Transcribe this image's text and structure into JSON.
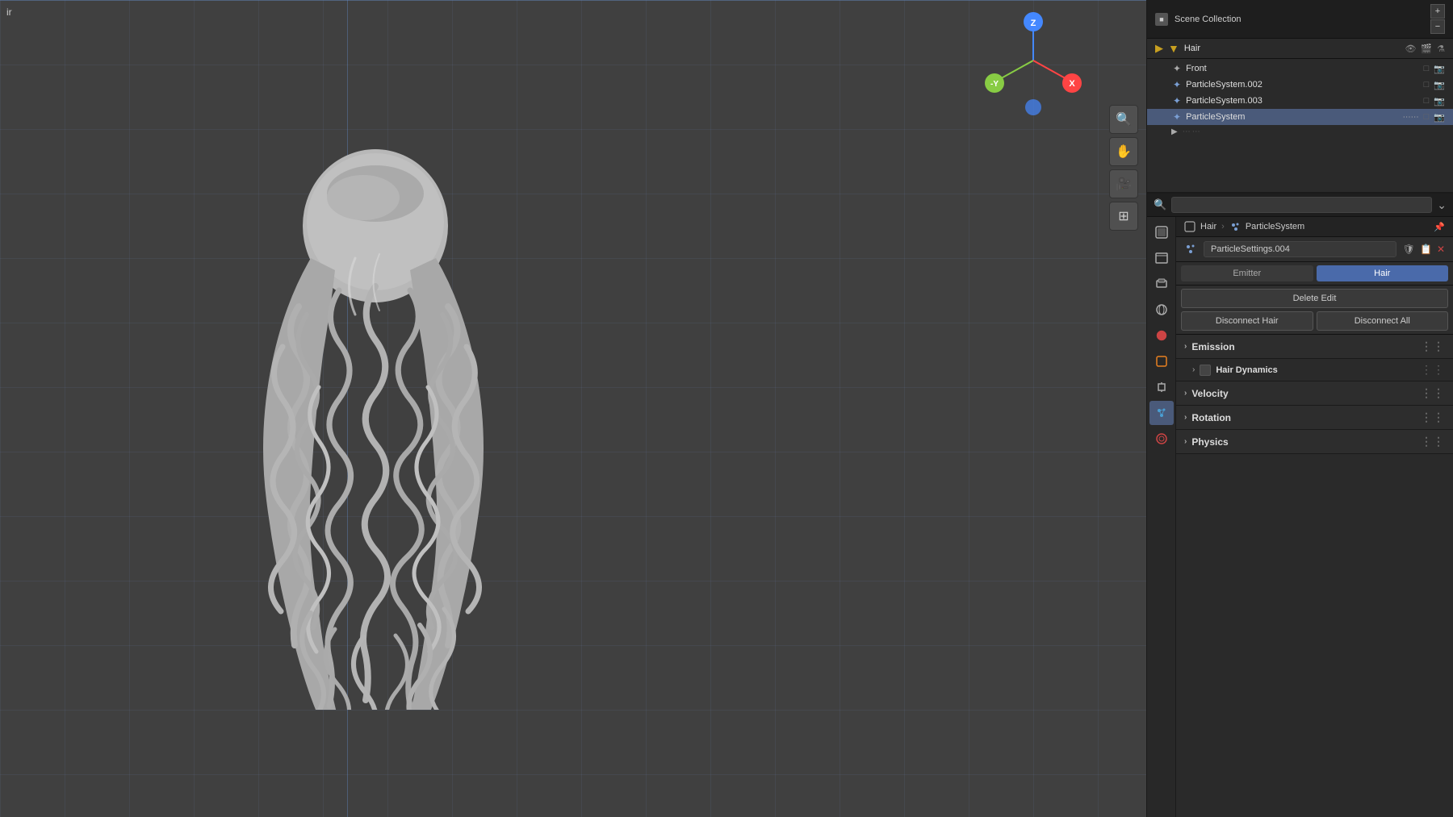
{
  "viewport": {
    "label": "ir",
    "background_color": "#3d3d3d"
  },
  "outliner": {
    "title": "Scene Collection",
    "search_placeholder": "🔍",
    "items": [
      {
        "id": "front",
        "label": "Front",
        "icon": "📷",
        "active": false
      },
      {
        "id": "ps002",
        "label": "ParticleSystem.002",
        "icon": "✦",
        "active": false
      },
      {
        "id": "ps003",
        "label": "ParticleSystem.003",
        "icon": "✦",
        "active": false
      },
      {
        "id": "ps",
        "label": "ParticleSystem",
        "icon": "✦",
        "active": true
      }
    ],
    "hair_label": "Hair",
    "expand_icon": "⌄"
  },
  "breadcrumb": {
    "items": [
      "Hair",
      "ParticleSystem"
    ],
    "icons": [
      "□",
      "✦"
    ]
  },
  "particle_settings": {
    "name": "ParticleSettings.004",
    "tabs": [
      {
        "id": "emitter",
        "label": "Emitter",
        "active": false
      },
      {
        "id": "hair",
        "label": "Hair",
        "active": true
      }
    ],
    "delete_edit_label": "Delete Edit",
    "disconnect_hair_label": "Disconnect Hair",
    "disconnect_all_label": "Disconnect All"
  },
  "sections": [
    {
      "id": "emission",
      "label": "Emission",
      "expanded": false
    },
    {
      "id": "hair_dynamics",
      "label": "Hair Dynamics",
      "expanded": false,
      "has_checkbox": true
    },
    {
      "id": "velocity",
      "label": "Velocity",
      "expanded": false
    },
    {
      "id": "rotation",
      "label": "Rotation",
      "expanded": false
    },
    {
      "id": "physics",
      "label": "Physics",
      "expanded": false
    }
  ],
  "props_sidebar": {
    "icons": [
      {
        "id": "render",
        "symbol": "🎬",
        "title": "Render Properties"
      },
      {
        "id": "output",
        "symbol": "🖼",
        "title": "Output Properties"
      },
      {
        "id": "view_layer",
        "symbol": "📷",
        "title": "View Layer Properties"
      },
      {
        "id": "scene",
        "symbol": "🌐",
        "title": "Scene Properties"
      },
      {
        "id": "world",
        "symbol": "◉",
        "title": "World Properties"
      },
      {
        "id": "object",
        "symbol": "▣",
        "title": "Object Properties",
        "active": true
      },
      {
        "id": "modifier",
        "symbol": "🔧",
        "title": "Modifier Properties"
      },
      {
        "id": "particles",
        "symbol": "✦",
        "title": "Particle Properties",
        "active": true
      },
      {
        "id": "physics2",
        "symbol": "⊙",
        "title": "Physics Properties"
      }
    ]
  },
  "nav_gizmo": {
    "z_color": "#4488ff",
    "y_color": "#88cc44",
    "x_color": "#ff4444",
    "neg_x_color": "#cc2222",
    "bottom_color": "#4488ff"
  }
}
